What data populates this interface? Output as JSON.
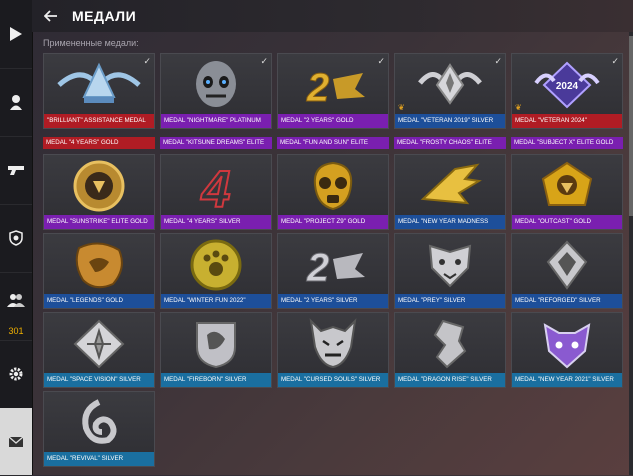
{
  "header": {
    "title": "МЕДАЛИ",
    "subtitle": "Примененные медали:"
  },
  "sidebar": {
    "friends_count": "301"
  },
  "colors": {
    "red": "#b01c24",
    "purple": "#7a1fb0",
    "blue": "#1d4f9a",
    "teal": "#1a6fa0",
    "gold_tint": "#d4a020"
  },
  "medals": [
    {
      "label": "\"BRILLIANT\" ASSISTANCE MEDAL",
      "color": "red"
    },
    {
      "label": "MEDAL \"NIGHTMARE\" PLATINUM",
      "color": "purple"
    },
    {
      "label": "MEDAL \"2 YEARS\" GOLD",
      "color": "purple"
    },
    {
      "label": "MEDAL \"VETERAN 2019\" SILVER",
      "color": "blue"
    },
    {
      "label": "MEDAL \"VETERAN 2024\"",
      "color": "red"
    },
    {
      "label": "MEDAL \"SUNSTRIKE\" ELITE GOLD",
      "color": "purple"
    },
    {
      "label": "MEDAL \"4 YEARS\" SILVER",
      "color": "purple"
    },
    {
      "label": "MEDAL \"PROJECT Z9\" GOLD",
      "color": "purple"
    },
    {
      "label": "MEDAL \"NEW YEAR MADNESS",
      "color": "blue"
    },
    {
      "label": "MEDAL \"OUTCAST\" GOLD",
      "color": "purple"
    },
    {
      "label": "MEDAL \"LEGENDS\" GOLD",
      "color": "blue"
    },
    {
      "label": "MEDAL \"WINTER FUN 2022\"",
      "color": "blue"
    },
    {
      "label": "MEDAL \"2 YEARS\" SILVER",
      "color": "blue"
    },
    {
      "label": "MEDAL \"PREY\" SILVER",
      "color": "blue"
    },
    {
      "label": "MEDAL \"REFORGED\" SILVER",
      "color": "blue"
    },
    {
      "label": "MEDAL \"SPACE VISION\" SILVER",
      "color": "teal"
    },
    {
      "label": "MEDAL \"FIREBORN\" SILVER",
      "color": "teal"
    },
    {
      "label": "MEDAL \"CURSED SOULS\" SILVER",
      "color": "teal"
    },
    {
      "label": "MEDAL \"DRAGON RISE\" SILVER",
      "color": "teal"
    },
    {
      "label": "MEDAL \"NEW YEAR 2021\" SILVER",
      "color": "teal"
    },
    {
      "label": "MEDAL \"REVIVAL\" SILVER",
      "color": "teal"
    }
  ],
  "strips": [
    {
      "label": "MEDAL \"4 YEARS\" GOLD",
      "color": "red"
    },
    {
      "label": "MEDAL \"KITSUNE DREAMS\" ELITE",
      "color": "purple"
    },
    {
      "label": "MEDAL \"FUN AND SUN\" ELITE",
      "color": "purple"
    },
    {
      "label": "MEDAL \"FROSTY CHAOS\" ELITE",
      "color": "purple"
    },
    {
      "label": "MEDAL \"SUBJECT X\" ELITE GOLD",
      "color": "purple"
    }
  ],
  "art_text": {
    "two_years": "2",
    "veteran_year": "2024",
    "four": "4"
  },
  "icons": [
    "play-icon",
    "soldier-icon",
    "pistol-icon",
    "shield-icon",
    "friends-icon",
    "gear-icon",
    "mail-icon",
    "back-arrow-icon",
    "check-icon",
    "wings-icon"
  ]
}
